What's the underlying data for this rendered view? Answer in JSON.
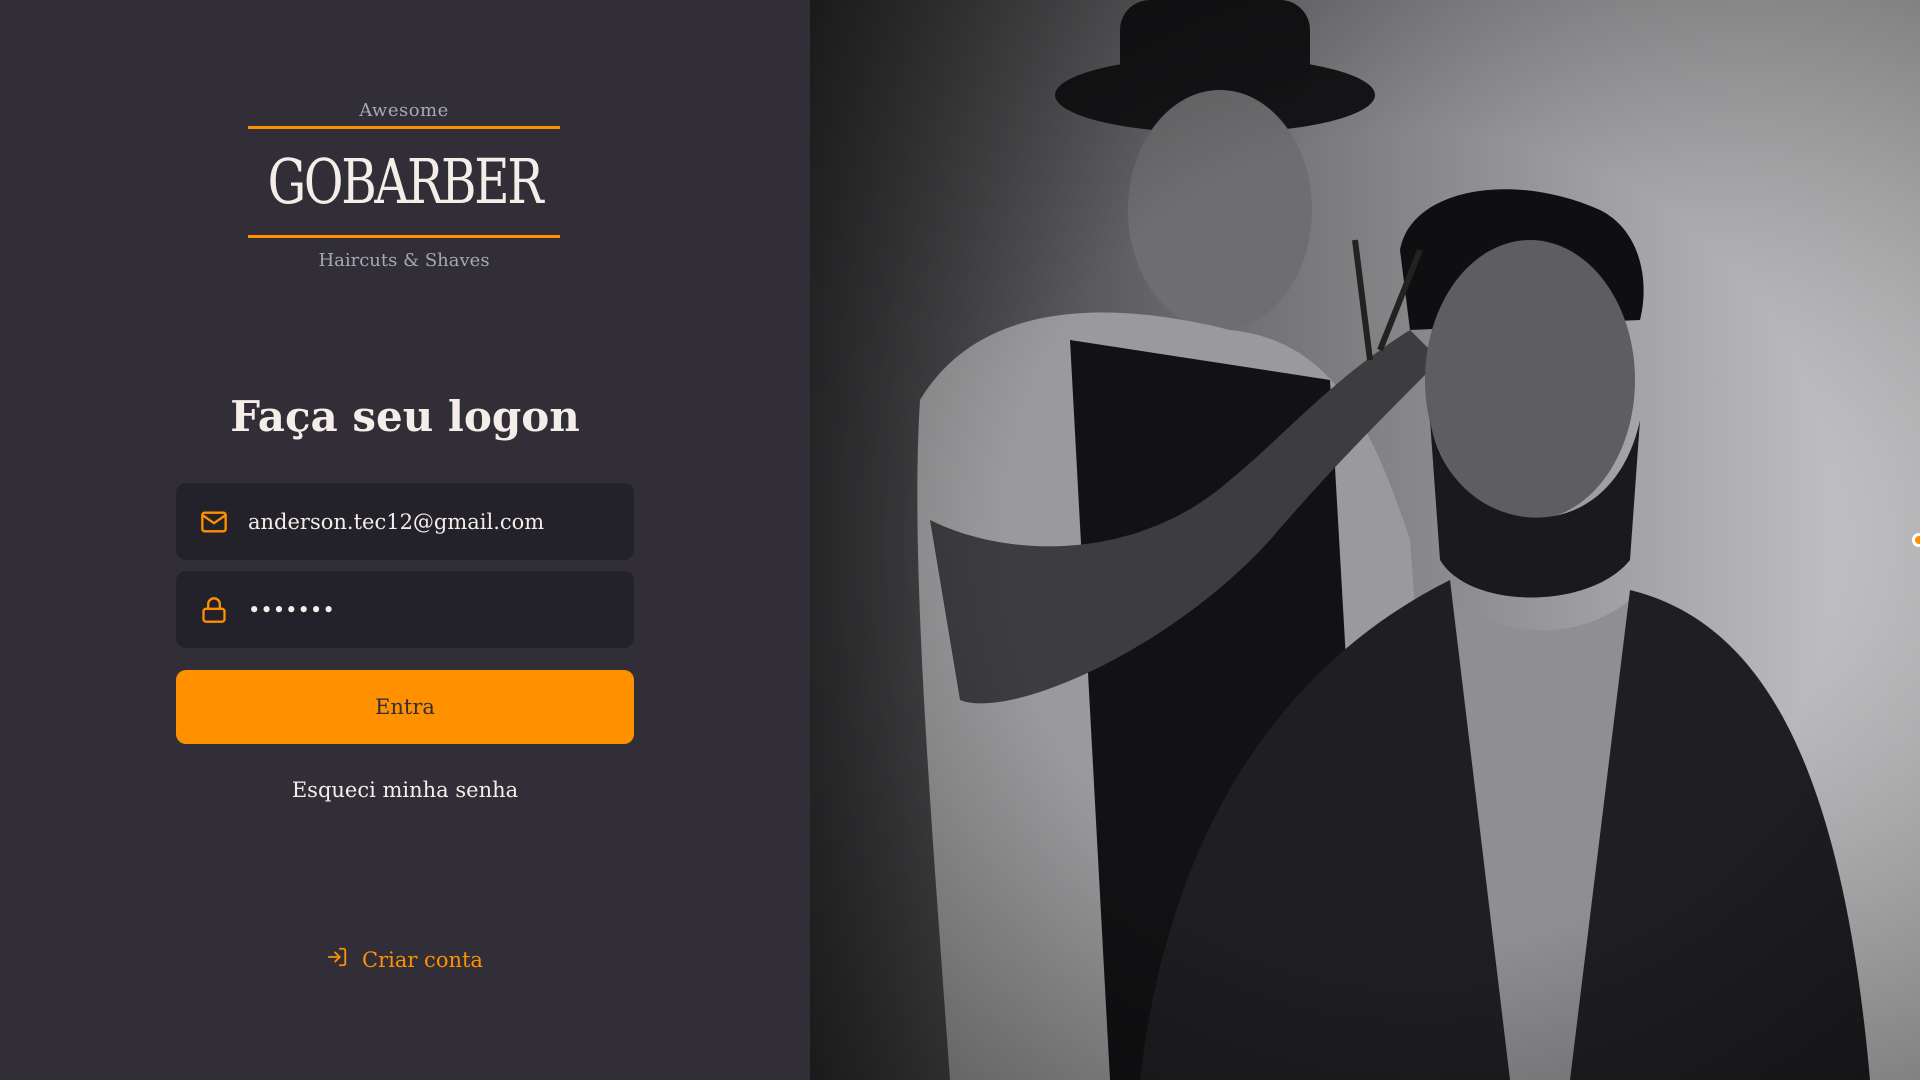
{
  "brand": {
    "top_label": "Awesome",
    "name": "GOBARBER",
    "bottom_label": "Haircuts & Shaves"
  },
  "form": {
    "title": "Faça seu logon",
    "email_value": "anderson.tec12@gmail.com",
    "password_value": "•••••••",
    "submit_label": "Entra",
    "forgot_label": "Esqueci minha senha"
  },
  "footer": {
    "create_account_label": "Criar conta"
  },
  "colors": {
    "accent": "#ff9000",
    "background": "#312e38",
    "input_background": "#232129",
    "text": "#f4ede8",
    "muted": "#a8a8b3"
  },
  "icons": {
    "email": "mail-icon",
    "password": "lock-icon",
    "create_account": "log-in-icon"
  }
}
